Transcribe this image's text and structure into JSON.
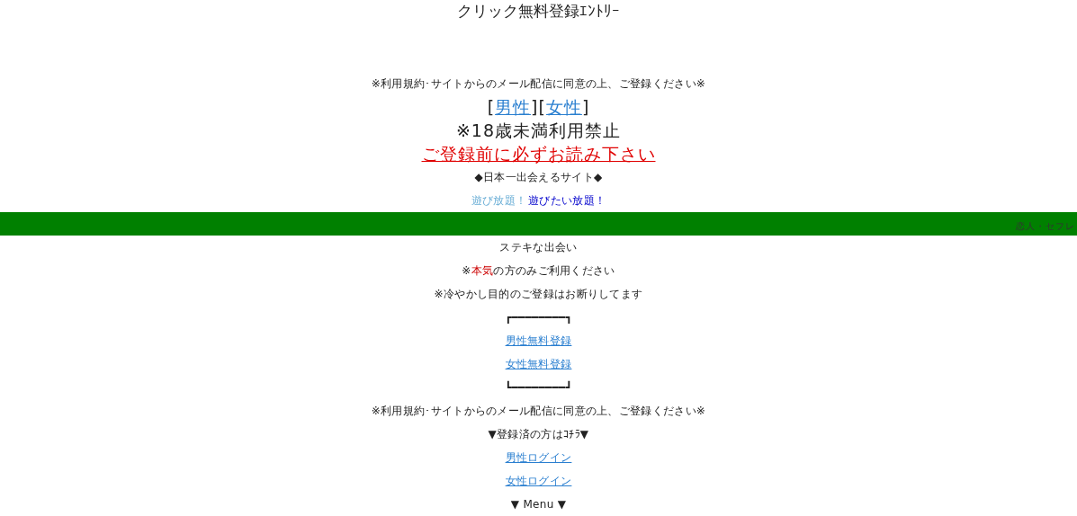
{
  "title": "クリック無料登録ｴﾝﾄﾘｰ",
  "notice_top": "※利用規約･サイトからのメール配信に同意の上、ご登録ください※",
  "gender_links": [
    {
      "open": "[",
      "label": "男性",
      "close": "]"
    },
    {
      "open": "[",
      "label": "女性",
      "close": "]"
    }
  ],
  "age_notice": "※18歳未満利用禁止",
  "read_first_link": "ご登録前に必ずお読み下さい",
  "tagline": "◆日本一出会えるサイト◆",
  "play_texts": [
    {
      "text": "遊び放題！",
      "kind": "light"
    },
    {
      "text": "遊びたい放題！",
      "kind": "strong"
    }
  ],
  "banner_text": "恋人・セフレ",
  "intro": "ステキな出会い",
  "serious_notice": [
    {
      "text": "※",
      "emphasis": false
    },
    {
      "text": "本気",
      "emphasis": true
    },
    {
      "text": "の方のみご利用ください",
      "emphasis": false
    }
  ],
  "tease_notice": "※冷やかし目的のご登録はお断りしてます",
  "bracket_top": "┏━━━━━━━━┓",
  "register_links": [
    {
      "label": "男性無料登録"
    },
    {
      "label": "女性無料登録"
    }
  ],
  "bracket_bottom": "┗━━━━━━━━┛",
  "notice_bottom": "※利用規約･サイトからのメール配信に同意の上、ご登録ください※",
  "registered_heading": "▼登録済の方はｺﾁﾗ▼",
  "login_links": [
    {
      "label": "男性ログイン"
    },
    {
      "label": "女性ログイン"
    }
  ],
  "menu_heading": "▼ Menu ▼"
}
